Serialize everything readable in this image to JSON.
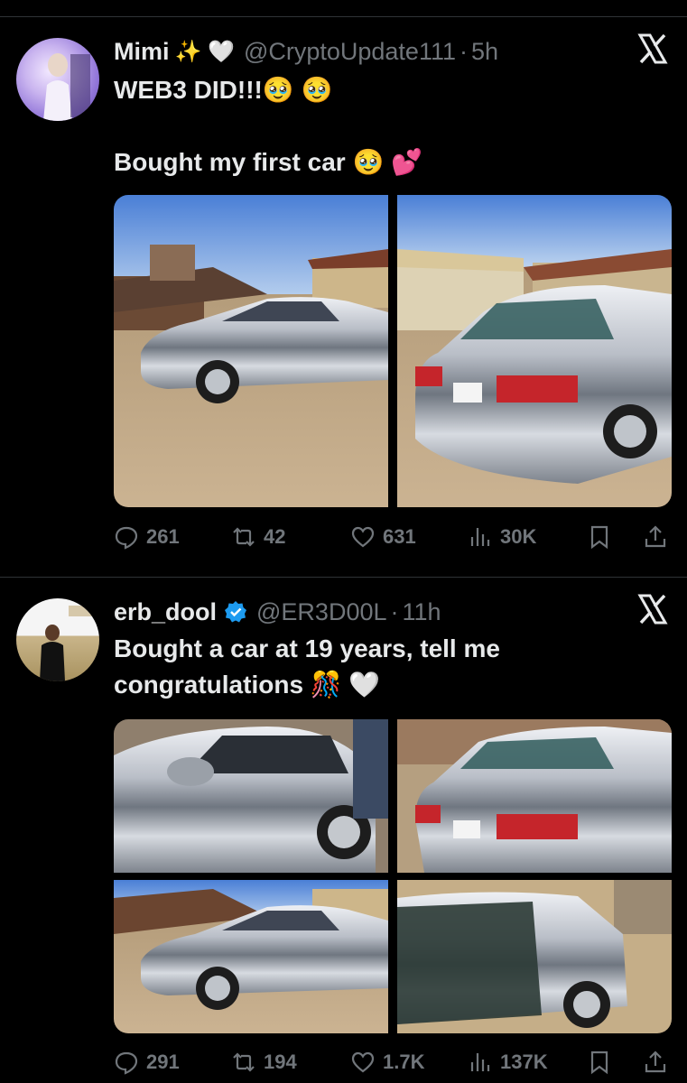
{
  "tweets": [
    {
      "name": "Mimi",
      "name_emojis": "✨ 🤍",
      "handle": "@CryptoUpdate111",
      "time": "5h",
      "text_line1": "WEB3 DID!!!🥹 🥹",
      "text_line2": "Bought my first car 🥹 💕",
      "replies": "261",
      "reposts": "42",
      "likes": "631",
      "views": "30K"
    },
    {
      "name": "erb_dool",
      "handle": "@ER3D00L",
      "time": "11h",
      "text_line1": "Bought a car at 19 years, tell me",
      "text_line2": "congratulations 🎊 🤍",
      "replies": "291",
      "reposts": "194",
      "likes": "1.7K",
      "views": "137K"
    }
  ],
  "separator": "·",
  "colors": {
    "background": "#000000",
    "text": "#e7e9ea",
    "muted": "#71767b",
    "verified": "#1d9bf0"
  },
  "icons": [
    "x-logo-icon",
    "reply-icon",
    "repost-icon",
    "like-icon",
    "views-icon",
    "bookmark-icon",
    "share-icon",
    "verified-badge-icon"
  ]
}
